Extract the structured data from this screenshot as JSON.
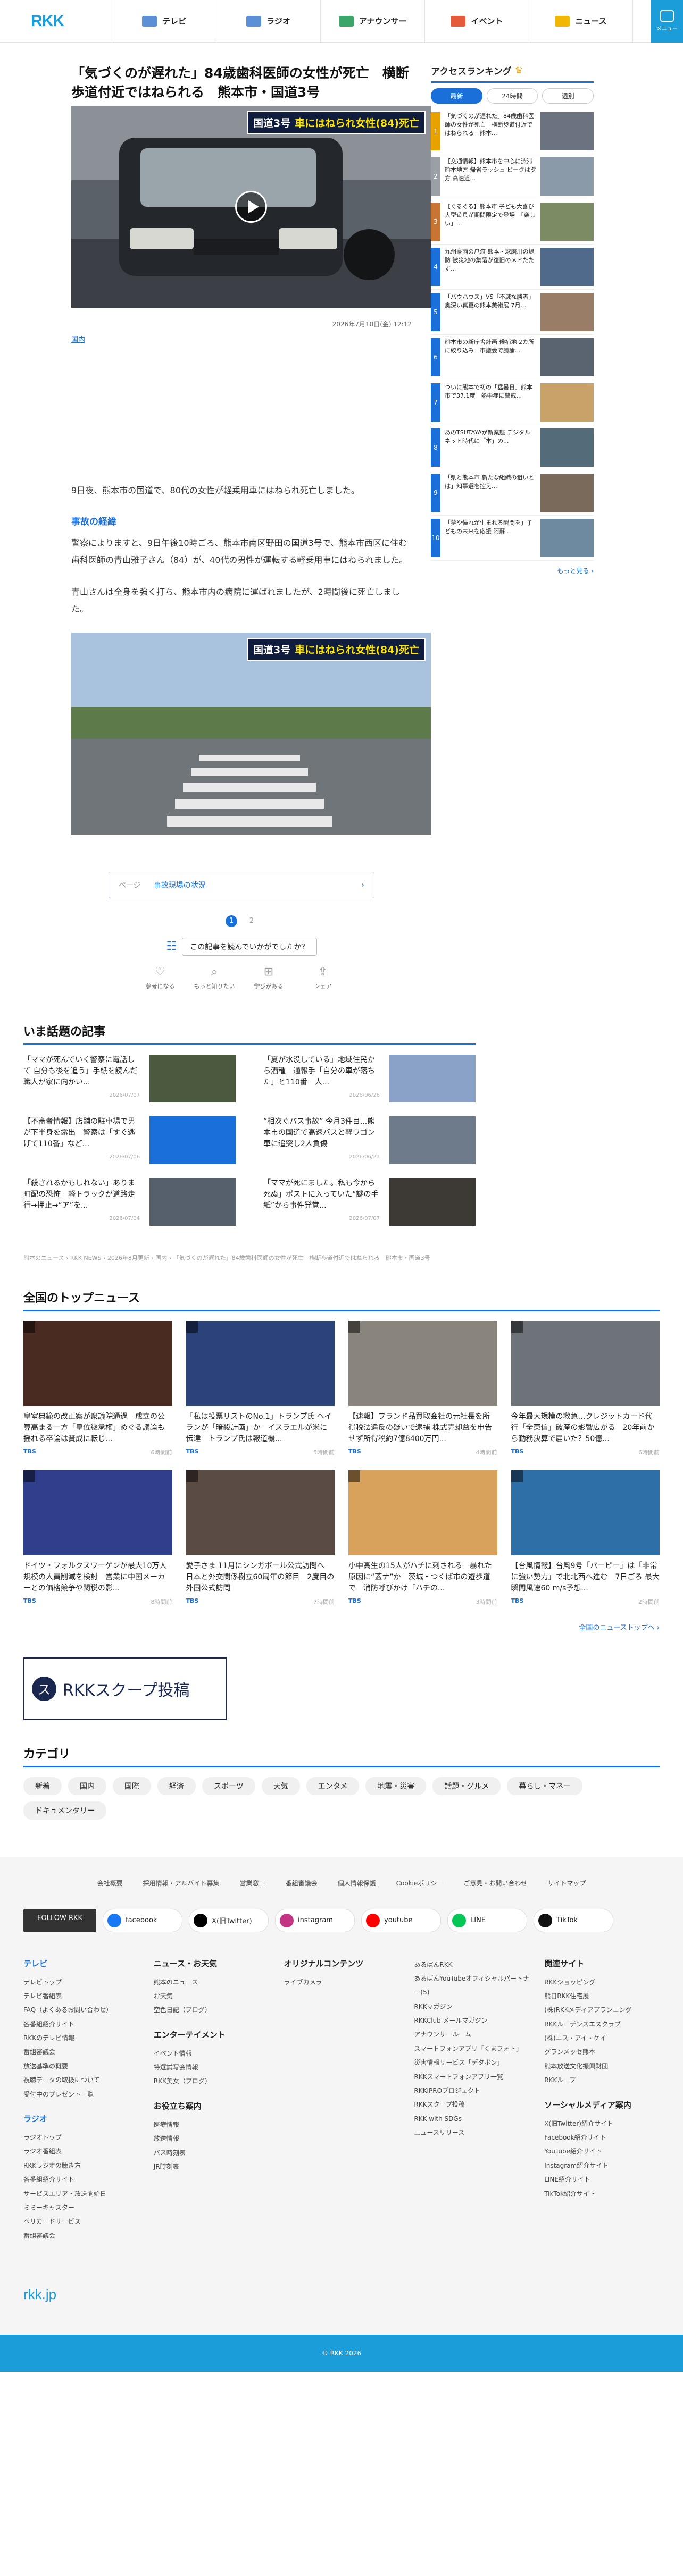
{
  "header": {
    "logo": "RKK",
    "nav": [
      {
        "label": "テレビ",
        "color": "#5b8fd6",
        "icon": "tv-icon"
      },
      {
        "label": "ラジオ",
        "color": "#5b8fd6",
        "icon": "radio-icon"
      },
      {
        "label": "アナウンサー",
        "color": "#3aa66a",
        "icon": "microphone-icon"
      },
      {
        "label": "イベント",
        "color": "#e55a3a",
        "icon": "event-icon"
      },
      {
        "label": "ニュース",
        "color": "#f2b705",
        "icon": "news-icon"
      }
    ],
    "menu_label": "メニュー"
  },
  "article": {
    "title": "「気づくのが遅れた」84歳歯科医師の女性が死亡　横断歩道付近ではねられる　熊本市・国道3号",
    "hero_caption_a": "国道3号",
    "hero_caption_b": "車にはねられ女性(84)死亡",
    "date": "2026年7月10日(金) 12:12",
    "category": "国内",
    "p1": "9日夜、熊本市の国道で、80代の女性が軽乗用車にはねられ死亡しました。",
    "h1": "事故の経緯",
    "p2": "警察によりますと、9日午後10時ごろ、熊本市南区野田の国道3号で、熊本市西区に住む歯科医師の青山雅子さん（84）が、40代の男性が運転する軽乗用車にはねられました。",
    "p3": "青山さんは全身を強く打ち、熊本市内の病院に運ばれましたが、2時間後に死亡しました。",
    "photo_caption_a": "国道3号",
    "photo_caption_b": "車にはねられ女性(84)死亡",
    "pager_label": "ページ",
    "pager_text": "事故現場の状況",
    "pages": [
      "1",
      "2"
    ],
    "question": "この記事を読んでいかがでしたか？",
    "reactions": [
      "参考になる",
      "もっと知りたい",
      "学びがある",
      "シェア"
    ]
  },
  "ranking": {
    "title": "アクセスランキング",
    "tabs": [
      "最新",
      "24時間",
      "週別"
    ],
    "items": [
      {
        "num": "1",
        "color": "#e8a200",
        "text": "「気づくのが遅れた」84歳歯科医師の女性が死亡　横断歩道付近ではねられる　熊本..."
      },
      {
        "num": "2",
        "color": "#9aa0a6",
        "text": "【交通情報】熊本市を中心に渋滞　熊本地方 帰省ラッシュ ピークは夕方 高速道..."
      },
      {
        "num": "3",
        "color": "#c87533",
        "text": "【ぐるぐる】熊本市 子ども大喜び 大型遊具が期間限定で登場　「楽しい」..."
      },
      {
        "num": "4",
        "color": "#1a6fd8",
        "text": "九州豪雨の爪痕 熊本・球磨川の堤防 被災地の集落が復旧のメドたたず..."
      },
      {
        "num": "5",
        "color": "#1a6fd8",
        "text": "「バウハウス」VS「不滅な勝者」 奥深い真夏の熊本美術展 7月..."
      },
      {
        "num": "6",
        "color": "#1a6fd8",
        "text": "熊本市の新庁舎計画 候補地 2カ所に絞り込み　市議会で議論..."
      },
      {
        "num": "7",
        "color": "#1a6fd8",
        "text": "ついに熊本で初の「猛暑日」熊本市で37.1度　熱中症に警戒..."
      },
      {
        "num": "8",
        "color": "#1a6fd8",
        "text": "あのTSUTAYAが新業態 デジタル ネット時代に「本」の..."
      },
      {
        "num": "9",
        "color": "#1a6fd8",
        "text": "「県と熊本市 新たな組織の狙いとは」知事選を控え..."
      },
      {
        "num": "10",
        "color": "#1a6fd8",
        "text": "「夢や憧れが生まれる瞬間を」子どもの未来を応援 阿蘇..."
      }
    ],
    "more": "もっと見る ›"
  },
  "related": {
    "title": "いま話題の記事",
    "items": [
      {
        "text": "「ママが死んでいく警察に電話して 自分も後を追う」手紙を読んだ職人が家に向かい...",
        "date": "2026/07/07",
        "color": "#4b5a3e"
      },
      {
        "text": "「夏が水没している」地域住民から酒種　通報手「自分の車が落ちた」と110番　人...",
        "date": "2026/06/26",
        "color": "#8aa2c8"
      },
      {
        "text": "【不審者情報】店舗の駐車場で男が下半身を露出　警察は「すぐ逃げて110番」など...",
        "date": "2026/07/06",
        "color": "#1a6fd8"
      },
      {
        "text": "“相次ぐバス事故” 今月3件目...熊本市の国道で高速バスと軽ワゴン車に追突し2人負傷",
        "date": "2026/06/21",
        "color": "#6e7b8a"
      },
      {
        "text": "「殺されるかもしれない」ありま町配の恐怖　軽トラックが道路走行→押止→“ア”を...",
        "date": "2026/07/04",
        "color": "#55606c"
      },
      {
        "text": "「ママが死にました。私も今から死ぬ」ポストに入っていた“謎の手紙”から事件発覚...",
        "date": "2026/07/07",
        "color": "#3d3a36"
      }
    ]
  },
  "breadcrumb": "熊本のニュース › RKK NEWS › 2026年8月更新 › 国内 › 「気づくのが遅れた」84歳歯科医師の女性が死亡　横断歩道付近ではねられる　熊本市・国道3号",
  "topnews": {
    "title": "全国のトップニュース",
    "items": [
      {
        "text": "皇室典範の改正案が衆議院通過　成立の公算高まる一方「皇位継承権」めぐる議論も　揺れる卒論は賛成に転じ...",
        "src": "TBS",
        "time": "6時間前",
        "color": "#4a2b22"
      },
      {
        "text": "「私は投票リストのNo.1」トランプ氏 ヘイランが「暗殺計画」か　イスラエルが米に伝達　トランプ氏は報道機...",
        "src": "TBS",
        "time": "5時間前",
        "color": "#2b4378"
      },
      {
        "text": "【速報】ブランド品買取会社の元社長を所得税法違反の疑いで逮捕 株式売却益を申告せず所得税約7億8400万円...",
        "src": "TBS",
        "time": "4時間前",
        "color": "#8a857c"
      },
      {
        "text": "今年最大規模の救急…クレジットカード代行「全東信」破産の影響広がる　20年前から勤務決算で届いた？50億...",
        "src": "TBS",
        "time": "6時間前",
        "color": "#6d7378"
      },
      {
        "text": "ドイツ・フォルクスワーゲンが最大10万人規模の人員削減を検討　営業に中国メーカーとの価格競争や関税の影...",
        "src": "TBS",
        "time": "8時間前",
        "color": "#2f3f8c"
      },
      {
        "text": "愛子さま 11月にシンガポール公式訪問へ　日本と外交関係樹立60周年の節目　2度目の外国公式訪問",
        "src": "TBS",
        "time": "7時間前",
        "color": "#5a4b44"
      },
      {
        "text": "小中高生の15人がハチに刺される　暴れた原因に“蓋ナ”か　茨城・つくば市の遊歩道で　消防呼びかけ「ハチの...",
        "src": "TBS",
        "time": "3時間前",
        "color": "#d8a15c"
      },
      {
        "text": "【台風情報】台風9号「パーピー」は「非常に強い勢力」で北北西へ進む　7日ごろ 最大瞬間風速60 m/s予想...",
        "src": "TBS",
        "time": "2時間前",
        "color": "#2f6fa8"
      }
    ],
    "more": "全国のニューストップへ ›"
  },
  "banner": {
    "icon": "ス",
    "text": "RKKスクープ投稿"
  },
  "categories": {
    "title": "カテゴリ",
    "items": [
      "新着",
      "国内",
      "国際",
      "経済",
      "スポーツ",
      "天気",
      "エンタメ",
      "地震・災害",
      "話題・グルメ",
      "暮らし・マネー",
      "ドキュメンタリー"
    ]
  },
  "footer": {
    "links": [
      "会社概要",
      "採用情報・アルバイト募集",
      "営業窓口",
      "番組審議会",
      "個人情報保護",
      "Cookieポリシー",
      "ご意見・お問い合わせ",
      "サイトマップ"
    ],
    "follow": "FOLLOW RKK",
    "socials": [
      {
        "label": "facebook",
        "color": "#1877f2"
      },
      {
        "label": "X(旧Twitter)",
        "color": "#000000"
      },
      {
        "label": "instagram",
        "color": "#c13584"
      },
      {
        "label": "youtube",
        "color": "#ff0000"
      },
      {
        "label": "LINE",
        "color": "#06c755"
      },
      {
        "label": "TikTok",
        "color": "#111111"
      }
    ],
    "cols": [
      {
        "head": "テレビ",
        "items": [
          "テレビトップ",
          "テレビ番組表",
          "FAQ（よくあるお問い合わせ）",
          "各番組紹介サイト",
          "RKKのテレビ情報",
          "番組審議会",
          "放送基準の概要",
          "視聴データの取扱について",
          "受付中のプレゼント一覧"
        ],
        "head2": "ラジオ",
        "items2": [
          "ラジオトップ",
          "ラジオ番組表",
          "RKKラジオの聴き方",
          "各番組紹介サイト",
          "サービスエリア・放送開始日",
          "ミミーキャスター",
          "ペリカードサービス",
          "番組審議会"
        ]
      },
      {
        "head": "ニュース・お天気",
        "items": [
          "熊本のニュース",
          "お天気",
          "空色日記（ブログ）"
        ],
        "head2": "エンターテイメント",
        "items2": [
          "イベント情報",
          "特選試写会情報",
          "RKK美女（ブログ）"
        ],
        "head3": "お役立ち案内",
        "items3": [
          "医療情報",
          "放送情報",
          "バス時刻表",
          "JR時刻表"
        ]
      },
      {
        "head": "オリジナルコンテンツ",
        "items": [
          "ライブカメラ"
        ],
        "head2": "",
        "items2": []
      },
      {
        "head": "",
        "items": [
          "あるばんRKK",
          "あるばんYouTubeオフィシャルパートナー(5)",
          "RKKマガジン",
          "RKKClub メールマガジン",
          "アナウンサールーム",
          "スマートフォンアプリ「くまフォト」",
          "災害情報サービス「デタポン」",
          "RKKスマートフォンアプリ一覧",
          "RKKIPROプロジェクト",
          "RKKスクープ投稿",
          "RKK with SDGs",
          "ニュースリリース"
        ],
        "head2": "",
        "items2": []
      },
      {
        "head": "関連サイト",
        "items": [
          "RKKショッピング",
          "熊日RKK住宅展",
          "(株)RKKメディアプランニング",
          "RKKルーデンスエスクラブ",
          "(株)エス・アイ・ケイ",
          "グランメッセ熊本",
          "熊本放送文化振興財団",
          "RKKループ"
        ],
        "head2": "ソーシャルメディア案内",
        "items2": [
          "X(旧Twitter)紹介サイト",
          "Facebook紹介サイト",
          "YouTube紹介サイト",
          "Instagram紹介サイト",
          "LINE紹介サイト",
          "TikTok紹介サイト"
        ]
      }
    ],
    "logo": "rkk.jp",
    "copyright": "© RKK 2026"
  }
}
